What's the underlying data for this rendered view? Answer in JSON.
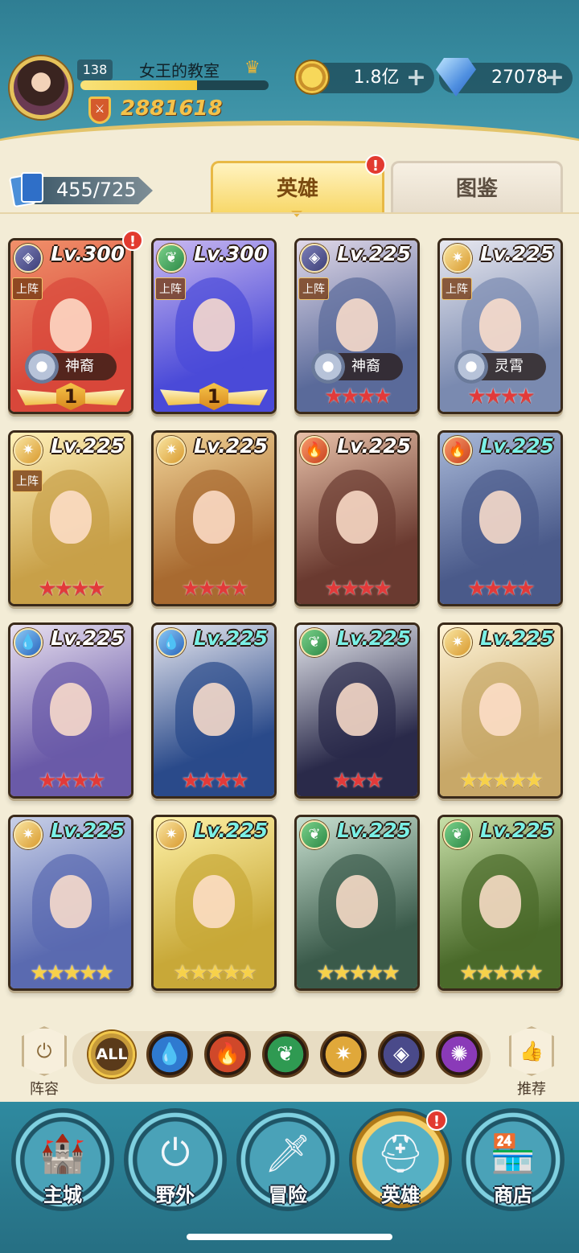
{
  "player": {
    "level": "138",
    "name": "女王的教室",
    "xp_fraction": 0.62,
    "power": "2881618"
  },
  "resources": {
    "gold": "1.8亿",
    "diamonds": "27078",
    "plus": "+"
  },
  "collection": {
    "count": "455/725"
  },
  "tabs": [
    {
      "label": "英雄",
      "active": true,
      "alert": "!"
    },
    {
      "label": "图鉴",
      "active": false
    }
  ],
  "heroes": [
    {
      "faction": "shadow",
      "faction_icon": "diamond-crest",
      "level": "Lv.300",
      "deployed_label": "上阵",
      "tag": "神裔",
      "rank": "1",
      "stars": "",
      "star_color": "",
      "alert": "!",
      "colors": [
        "#d8473a",
        "#f0906a"
      ]
    },
    {
      "faction": "forest",
      "faction_icon": "leaf",
      "level": "Lv.300",
      "deployed_label": "上阵",
      "tag": "",
      "rank": "1",
      "stars": "",
      "star_color": "",
      "alert": "",
      "colors": [
        "#4a4ad8",
        "#c9b8f0"
      ]
    },
    {
      "faction": "shadow",
      "faction_icon": "diamond-crest",
      "level": "Lv.225",
      "deployed_label": "上阵",
      "tag": "神裔",
      "rank": "",
      "stars": "★★★★",
      "star_color": "red",
      "alert": "",
      "colors": [
        "#5a6a9a",
        "#e0d8e8"
      ]
    },
    {
      "faction": "light",
      "faction_icon": "sun-star",
      "level": "Lv.225",
      "deployed_label": "上阵",
      "tag": "灵霄",
      "rank": "",
      "stars": "★★★★",
      "star_color": "red",
      "alert": "",
      "colors": [
        "#7a8ab0",
        "#e8e8f0"
      ]
    },
    {
      "faction": "light",
      "faction_icon": "sun-star",
      "level": "Lv.225",
      "deployed_label": "上阵",
      "tag": "",
      "rank": "",
      "stars": "★★★★",
      "star_color": "red",
      "alert": "",
      "colors": [
        "#c8a048",
        "#fff0b8"
      ]
    },
    {
      "faction": "light",
      "faction_icon": "sun-star",
      "level": "Lv.225",
      "deployed_label": "",
      "tag": "",
      "rank": "",
      "stars": "★★★★",
      "star_color": "red",
      "alert": "",
      "colors": [
        "#a86a30",
        "#f2d498"
      ]
    },
    {
      "faction": "fire",
      "faction_icon": "flame",
      "level": "Lv.225",
      "deployed_label": "",
      "tag": "",
      "rank": "",
      "stars": "★★★★",
      "star_color": "red",
      "alert": "",
      "colors": [
        "#6a3a30",
        "#e8c0a8"
      ]
    },
    {
      "faction": "fire",
      "faction_icon": "flame",
      "level": "Lv.225",
      "deployed_label": "",
      "tag": "",
      "rank": "",
      "stars": "★★★★",
      "star_color": "red",
      "alert": "",
      "colors": [
        "#4a5a8a",
        "#a8b8d8"
      ]
    },
    {
      "faction": "water",
      "faction_icon": "water-drop",
      "level": "Lv.225",
      "deployed_label": "",
      "tag": "",
      "rank": "",
      "stars": "★★★★",
      "star_color": "red",
      "alert": "",
      "colors": [
        "#6a5aa8",
        "#e8e0f0"
      ]
    },
    {
      "faction": "water",
      "faction_icon": "water-drop",
      "level": "Lv.225",
      "deployed_label": "",
      "tag": "",
      "rank": "",
      "stars": "★★★★",
      "star_color": "red",
      "alert": "",
      "colors": [
        "#2a4a8a",
        "#e8e8f0"
      ]
    },
    {
      "faction": "forest",
      "faction_icon": "leaf",
      "level": "Lv.225",
      "deployed_label": "",
      "tag": "",
      "rank": "",
      "stars": "★★★",
      "star_color": "red",
      "alert": "",
      "colors": [
        "#2a2a4a",
        "#e8eaf0"
      ]
    },
    {
      "faction": "light",
      "faction_icon": "sun-star",
      "level": "Lv.225",
      "deployed_label": "",
      "tag": "",
      "rank": "",
      "stars": "★★★★★",
      "star_color": "gold",
      "alert": "",
      "colors": [
        "#c8a868",
        "#fff4d8"
      ]
    },
    {
      "faction": "light",
      "faction_icon": "sun-star",
      "level": "Lv.225",
      "deployed_label": "",
      "tag": "",
      "rank": "",
      "stars": "★★★★★",
      "star_color": "gold",
      "alert": "",
      "colors": [
        "#5a6ab0",
        "#c8d0e8"
      ]
    },
    {
      "faction": "light",
      "faction_icon": "sun-star",
      "level": "Lv.225",
      "deployed_label": "",
      "tag": "",
      "rank": "",
      "stars": "★★★★★",
      "star_color": "gold",
      "alert": "",
      "colors": [
        "#c8a838",
        "#fff2a8"
      ]
    },
    {
      "faction": "forest",
      "faction_icon": "leaf",
      "level": "Lv.225",
      "deployed_label": "",
      "tag": "",
      "rank": "",
      "stars": "★★★★★",
      "star_color": "gold",
      "alert": "",
      "colors": [
        "#3a5a4a",
        "#c8e0d0"
      ]
    },
    {
      "faction": "forest",
      "faction_icon": "leaf",
      "level": "Lv.225",
      "deployed_label": "",
      "tag": "",
      "rank": "",
      "stars": "★★★★★",
      "star_color": "gold",
      "alert": "",
      "colors": [
        "#4a6a2a",
        "#c8e0a8"
      ]
    }
  ],
  "filters": {
    "left_button": "阵容",
    "right_button": "推荐",
    "all_label": "ALL",
    "factions": [
      {
        "name": "water",
        "icon": "water-drop",
        "color": "#2f7ad0"
      },
      {
        "name": "fire",
        "icon": "flame",
        "color": "#d0482a"
      },
      {
        "name": "forest",
        "icon": "leaf",
        "color": "#2f9a52"
      },
      {
        "name": "light",
        "icon": "sun-star",
        "color": "#e0a83a"
      },
      {
        "name": "shadow",
        "icon": "diamond-crest",
        "color": "#4a4a8a"
      },
      {
        "name": "arcane",
        "icon": "swirl",
        "color": "#8a3ab8"
      }
    ]
  },
  "nav": [
    {
      "label": "主城",
      "icon": "castle",
      "active": false,
      "alert": ""
    },
    {
      "label": "野外",
      "icon": "portal",
      "active": false,
      "alert": ""
    },
    {
      "label": "冒险",
      "icon": "sword",
      "active": false,
      "alert": ""
    },
    {
      "label": "英雄",
      "icon": "helmet",
      "active": true,
      "alert": "!"
    },
    {
      "label": "商店",
      "icon": "shop",
      "active": false,
      "alert": ""
    }
  ]
}
